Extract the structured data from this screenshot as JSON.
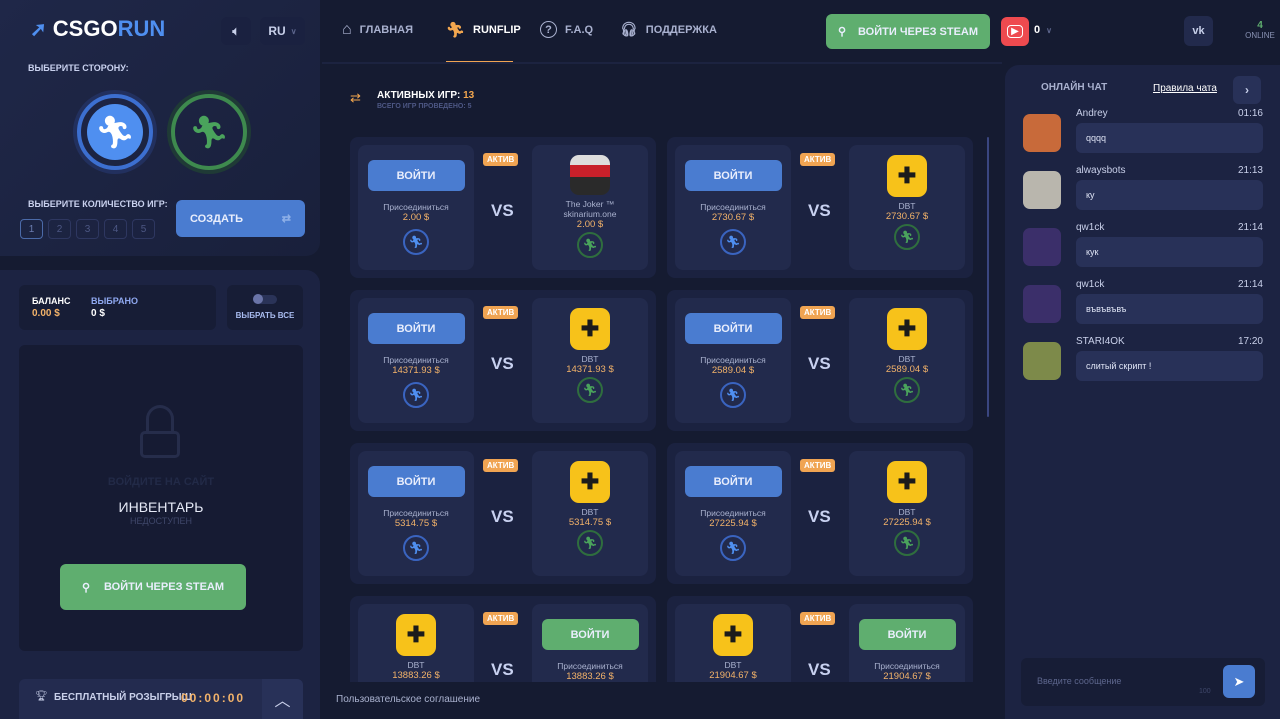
{
  "brand": {
    "logo_a": "CSGO",
    "logo_b": "RUN"
  },
  "left": {
    "lang": "RU",
    "choose_side": "ВЫБЕРИТЕ СТОРОНУ:",
    "choose_count": "ВЫБЕРИТЕ КОЛИЧЕСТВО ИГР:",
    "counts": [
      "1",
      "2",
      "3",
      "4",
      "5"
    ],
    "create": "СОЗДАТЬ",
    "balance_label": "БАЛАНС",
    "balance": "0.00 $",
    "selected_label": "ВЫБРАНО",
    "selected": "0 $",
    "select_all": "ВЫБРАТЬ ВСЕ",
    "login_hint": "ВОЙДИТЕ НА САЙТ",
    "inventory": "ИНВЕНТАРЬ",
    "unavailable": "НЕДОСТУПЕН",
    "steam_login": "ВОЙТИ ЧЕРЕЗ STEAM",
    "giveaway": "БЕСПЛАТНЫЙ РОЗЫГРЫШ",
    "timer": "00:00:00"
  },
  "nav": {
    "home": "ГЛАВНАЯ",
    "runflip": "RUNFLIP",
    "faq": "F.A.Q",
    "support": "ПОДДЕРЖКА",
    "steam_login": "ВОЙТИ ЧЕРЕЗ STEAM",
    "youtube_count": "0",
    "online_count": "4",
    "online_label": "ONLINE"
  },
  "games_header": {
    "active_label": "АКТИВНЫХ ИГР:",
    "active_count": "13",
    "total": "ВСЕГО ИГР ПРОВЕДЕНО: 5"
  },
  "games": [
    {
      "first": "join",
      "join_label": "ВОЙТИ",
      "join_text": "Присоединиться",
      "price": "2.00 $",
      "player": "The Joker ™ skinarium.one",
      "player_price": "2.00 $",
      "badge": "АКТИВ",
      "vs": "VS",
      "avatar": "joker"
    },
    {
      "first": "join",
      "join_label": "ВОЙТИ",
      "join_text": "Присоединиться",
      "price": "2730.67 $",
      "player": "DBT",
      "player_price": "2730.67 $",
      "badge": "АКТИВ",
      "vs": "VS",
      "avatar": "shield"
    },
    {
      "first": "join",
      "join_label": "ВОЙТИ",
      "join_text": "Присоединиться",
      "price": "14371.93 $",
      "player": "DBT",
      "player_price": "14371.93 $",
      "badge": "АКТИВ",
      "vs": "VS",
      "avatar": "shield"
    },
    {
      "first": "join",
      "join_label": "ВОЙТИ",
      "join_text": "Присоединиться",
      "price": "2589.04 $",
      "player": "DBT",
      "player_price": "2589.04 $",
      "badge": "АКТИВ",
      "vs": "VS",
      "avatar": "shield"
    },
    {
      "first": "join",
      "join_label": "ВОЙТИ",
      "join_text": "Присоединиться",
      "price": "5314.75 $",
      "player": "DBT",
      "player_price": "5314.75 $",
      "badge": "АКТИВ",
      "vs": "VS",
      "avatar": "shield"
    },
    {
      "first": "join",
      "join_label": "ВОЙТИ",
      "join_text": "Присоединиться",
      "price": "27225.94 $",
      "player": "DBT",
      "player_price": "27225.94 $",
      "badge": "АКТИВ",
      "vs": "VS",
      "avatar": "shield"
    },
    {
      "first": "player",
      "join_label": "ВОЙТИ",
      "join_text": "Присоединиться",
      "price": "13883.26 $",
      "player": "DBT",
      "player_price": "13883.26 $",
      "badge": "АКТИВ",
      "vs": "VS",
      "avatar": "shield"
    },
    {
      "first": "player",
      "join_label": "ВОЙТИ",
      "join_text": "Присоединиться",
      "price": "21904.67 $",
      "player": "DBT",
      "player_price": "21904.67 $",
      "badge": "АКТИВ",
      "vs": "VS",
      "avatar": "shield"
    }
  ],
  "footer": {
    "agreement": "Пользовательское соглашение"
  },
  "chat": {
    "title": "ОНЛАЙН ЧАТ",
    "rules": "Правила чата",
    "placeholder": "Введите сообщение",
    "limit": "100",
    "messages": [
      {
        "user": "Andrey",
        "time": "01:16",
        "text": "qqqq",
        "color": "#c86a3a"
      },
      {
        "user": "alwaysbots",
        "time": "21:13",
        "text": "ку",
        "color": "#b9b6ad"
      },
      {
        "user": "qw1ck",
        "time": "21:14",
        "text": "кук",
        "color": "#3b2f6a"
      },
      {
        "user": "qw1ck",
        "time": "21:14",
        "text": "въвъвъвъ",
        "color": "#3b2f6a"
      },
      {
        "user": "STARI4OK",
        "time": "17:20",
        "text": "слитый скрипт !",
        "color": "#7d8a4a"
      }
    ]
  }
}
